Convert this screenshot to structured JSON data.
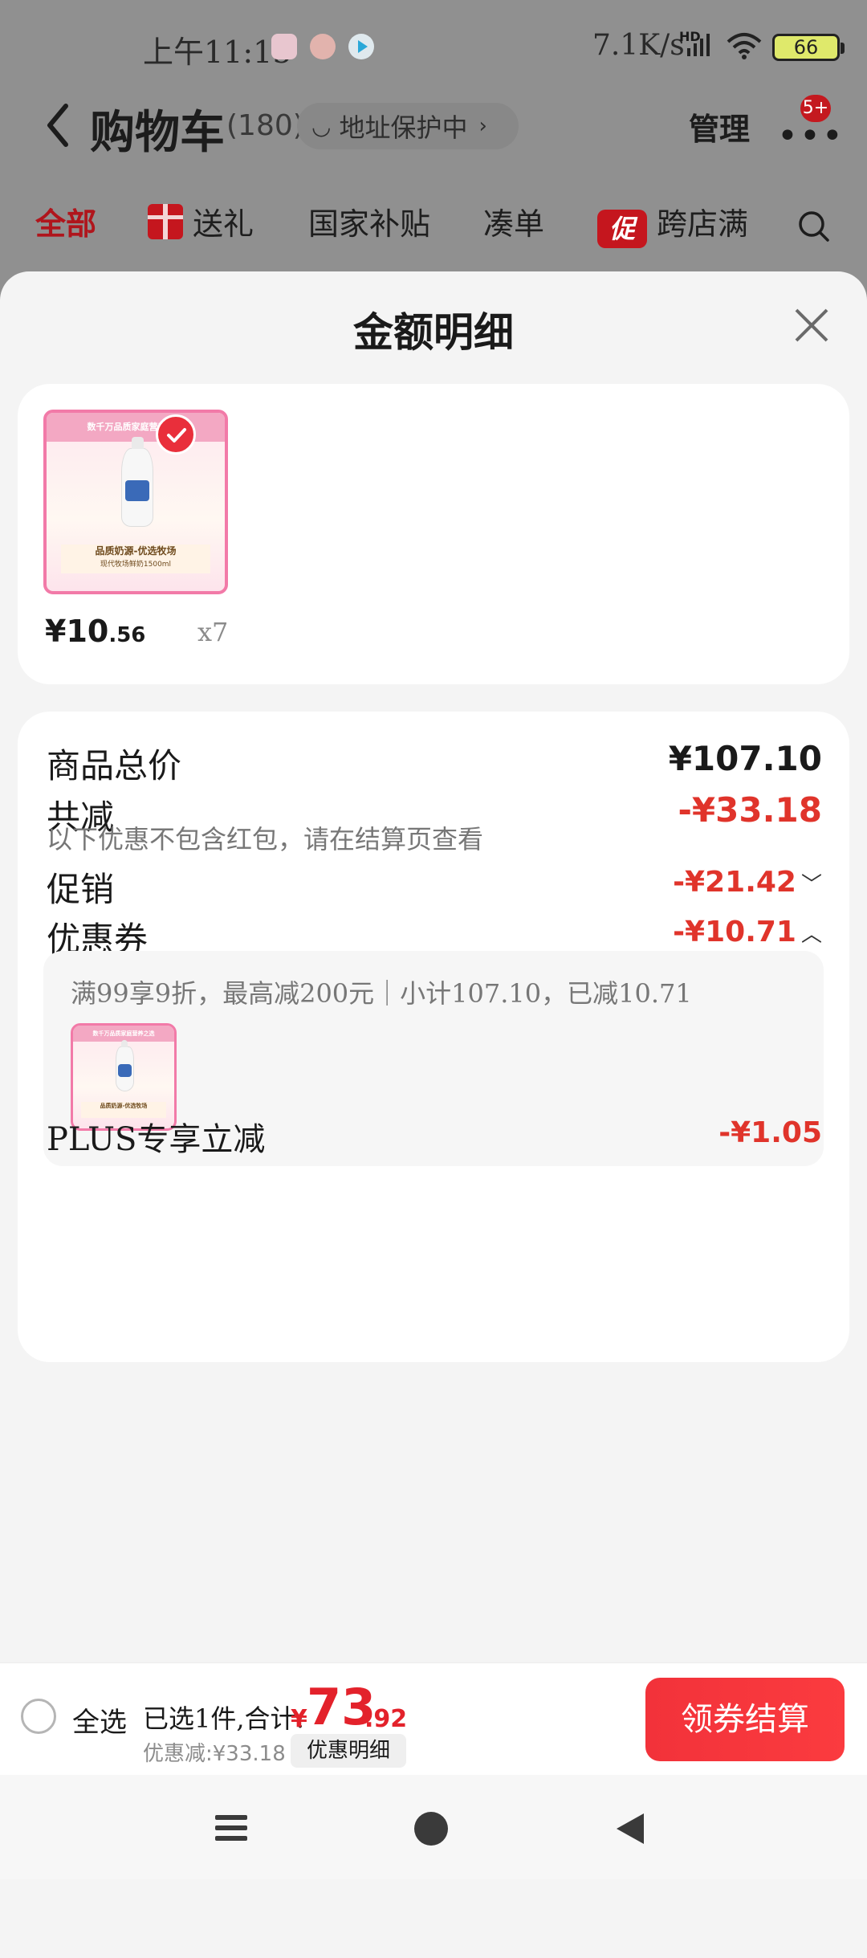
{
  "status_bar": {
    "time": "上午11:15",
    "network_speed": "7.1K/s",
    "network_type": "HD",
    "battery": "66",
    "icons": [
      "notification-app-icon",
      "notification-app-icon",
      "play-icon",
      "signal-icon",
      "wifi-icon",
      "battery-icon"
    ]
  },
  "header": {
    "title": "购物车",
    "count": "(180)",
    "address_protect": "地址保护中",
    "manage": "管理",
    "message_badge": "5+"
  },
  "tabs": [
    {
      "label": "全部",
      "active": true
    },
    {
      "label": "送礼",
      "icon": "gift-icon"
    },
    {
      "label": "国家补贴"
    },
    {
      "label": "凑单"
    },
    {
      "label": "跨店满",
      "icon_text": "促"
    }
  ],
  "sheet": {
    "title": "金额明细",
    "product": {
      "banner_text": "数千万品质家庭营养之选",
      "caption_1": "品质奶源-优选牧场",
      "caption_2": "现代牧场鲜奶1500ml",
      "price_int": "¥10",
      "price_dec": ".56",
      "quantity": "x7"
    },
    "details": {
      "total_label": "商品总价",
      "total_value": "¥107.10",
      "reduce_label": "共减",
      "reduce_value": "-¥33.18",
      "reduce_note": "以下优惠不包含红包，请在结算页查看",
      "promo_label": "促销",
      "promo_value": "-¥21.42",
      "coupon_label": "优惠券",
      "coupon_value": "-¥10.71",
      "coupon_desc": "满99享9折，最高减200元｜小计107.10，已减10.71",
      "plus_label": "PLUS专享立减",
      "plus_value": "-¥1.05"
    }
  },
  "checkout": {
    "select_all": "全选",
    "selected": "已选1件,合计:",
    "currency": "¥",
    "total_int": "73",
    "total_dec": ".92",
    "discount": "优惠减:¥33.18",
    "detail_button": "优惠明细",
    "checkout_button": "领券结算"
  },
  "colors": {
    "accent_red": "#e0342b",
    "checkout_red": "#f2323a",
    "product_border_pink": "#f27aa8"
  }
}
